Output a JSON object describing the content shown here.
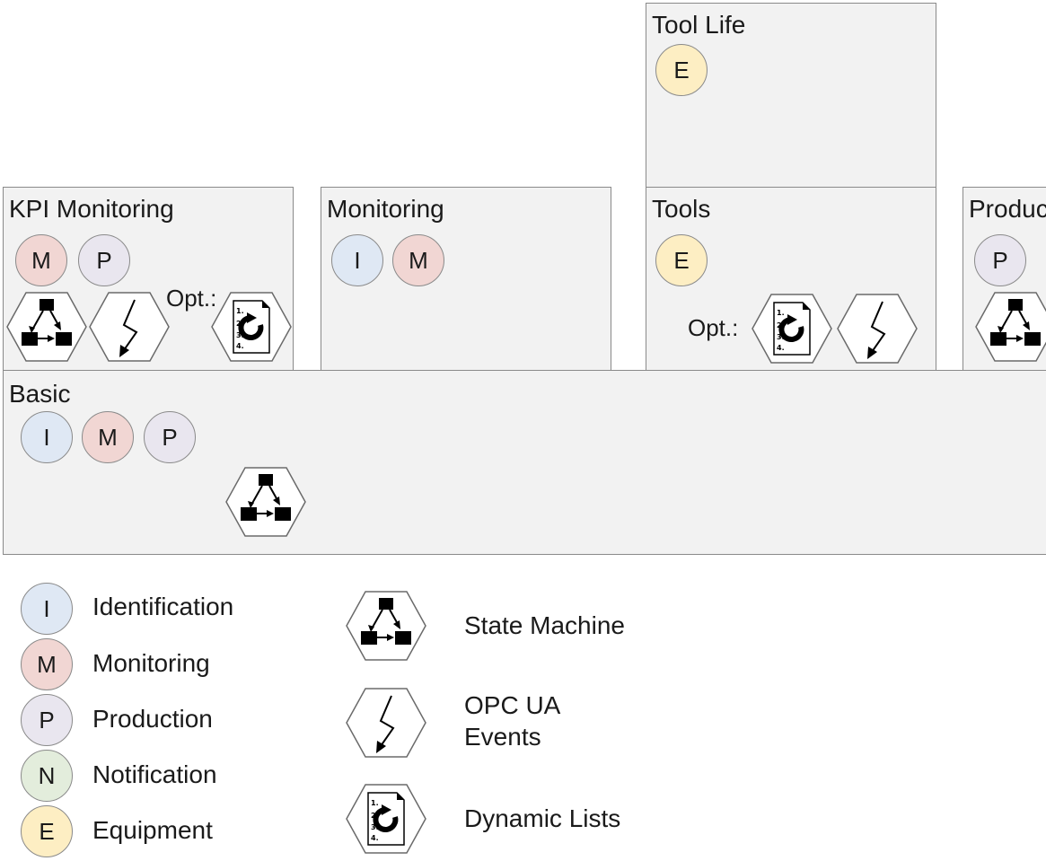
{
  "colors": {
    "identification": "#dfe8f4",
    "monitoring": "#f1d6d3",
    "production": "#e9e6ef",
    "notification": "#e3eddc",
    "equipment": "#fdeec3",
    "box_fill": "#f2f2f2",
    "border": "#8a8a8a"
  },
  "boxes": {
    "tool_life": {
      "title": "Tool Life",
      "badges": [
        "E"
      ]
    },
    "kpi_monitoring": {
      "title": "KPI Monitoring",
      "badges": [
        "M",
        "P"
      ],
      "opt_label": "Opt.:",
      "icons": [
        "state-machine-icon",
        "opc-ua-events-icon",
        "dynamic-lists-icon"
      ]
    },
    "monitoring": {
      "title": "Monitoring",
      "badges": [
        "I",
        "M"
      ]
    },
    "tools": {
      "title": "Tools",
      "badges": [
        "E"
      ],
      "opt_label": "Opt.:",
      "icons": [
        "dynamic-lists-icon",
        "opc-ua-events-icon"
      ]
    },
    "production": {
      "title": "Produc",
      "badges": [
        "P"
      ],
      "icons": [
        "state-machine-icon"
      ]
    },
    "basic": {
      "title": "Basic",
      "badges": [
        "I",
        "M",
        "P"
      ],
      "icons": [
        "state-machine-icon"
      ]
    }
  },
  "legend": {
    "badges": [
      {
        "letter": "I",
        "label": "Identification"
      },
      {
        "letter": "M",
        "label": "Monitoring"
      },
      {
        "letter": "P",
        "label": "Production"
      },
      {
        "letter": "N",
        "label": "Notification"
      },
      {
        "letter": "E",
        "label": "Equipment"
      }
    ],
    "icons": [
      {
        "icon": "state-machine-icon",
        "lines": [
          "State Machine"
        ]
      },
      {
        "icon": "opc-ua-events-icon",
        "lines": [
          "OPC UA",
          "Events"
        ]
      },
      {
        "icon": "dynamic-lists-icon",
        "lines": [
          "Dynamic Lists"
        ]
      }
    ]
  }
}
